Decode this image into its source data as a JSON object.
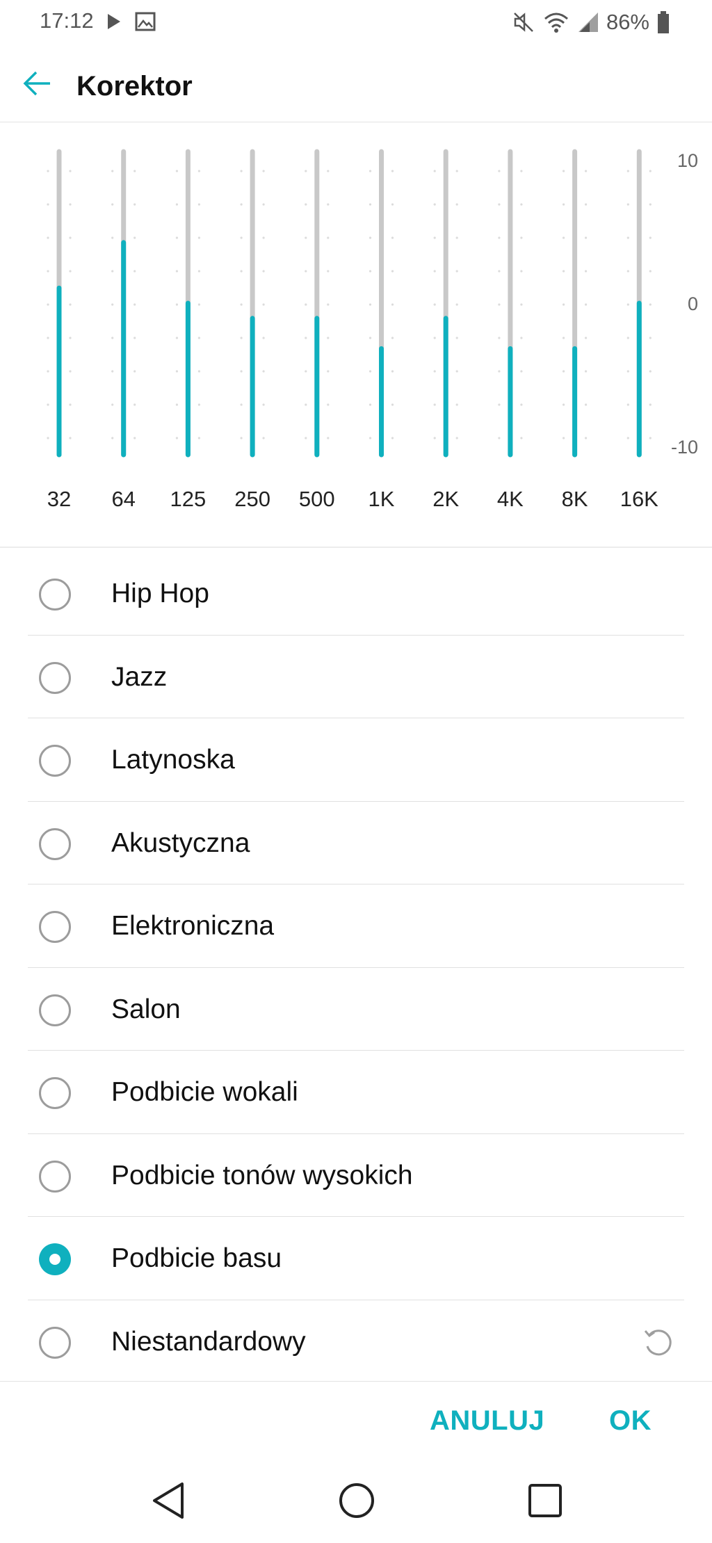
{
  "status_bar": {
    "time": "17:12",
    "battery": "86%",
    "icons": [
      "play-icon",
      "image-icon",
      "muted-icon",
      "wifi-icon",
      "signal-icon",
      "battery-icon"
    ]
  },
  "app_bar": {
    "title": "Korektor",
    "back_icon": "arrow-left-icon"
  },
  "equalizer": {
    "scale": {
      "max": "10",
      "mid": "0",
      "min": "-10"
    },
    "range": [
      -10,
      10
    ],
    "bands": [
      {
        "label": "32",
        "gain": 1
      },
      {
        "label": "64",
        "gain": 4
      },
      {
        "label": "125",
        "gain": 0
      },
      {
        "label": "250",
        "gain": -1
      },
      {
        "label": "500",
        "gain": -1
      },
      {
        "label": "1K",
        "gain": -3
      },
      {
        "label": "2K",
        "gain": -1
      },
      {
        "label": "4K",
        "gain": -3
      },
      {
        "label": "8K",
        "gain": -3
      },
      {
        "label": "16K",
        "gain": 0
      }
    ]
  },
  "presets": [
    {
      "label": "Hip Hop",
      "selected": false
    },
    {
      "label": "Jazz",
      "selected": false
    },
    {
      "label": "Latynoska",
      "selected": false
    },
    {
      "label": "Akustyczna",
      "selected": false
    },
    {
      "label": "Elektroniczna",
      "selected": false
    },
    {
      "label": "Salon",
      "selected": false
    },
    {
      "label": "Podbicie wokali",
      "selected": false
    },
    {
      "label": "Podbicie tonów wysokich",
      "selected": false
    },
    {
      "label": "Podbicie basu",
      "selected": true
    },
    {
      "label": "Niestandardowy",
      "selected": false,
      "reset_icon": "reset-icon"
    }
  ],
  "actions": {
    "cancel": "ANULUJ",
    "ok": "OK"
  },
  "colors": {
    "accent": "#0fb0be",
    "track": "#c8c8c8",
    "divider": "#e0e0e0"
  }
}
